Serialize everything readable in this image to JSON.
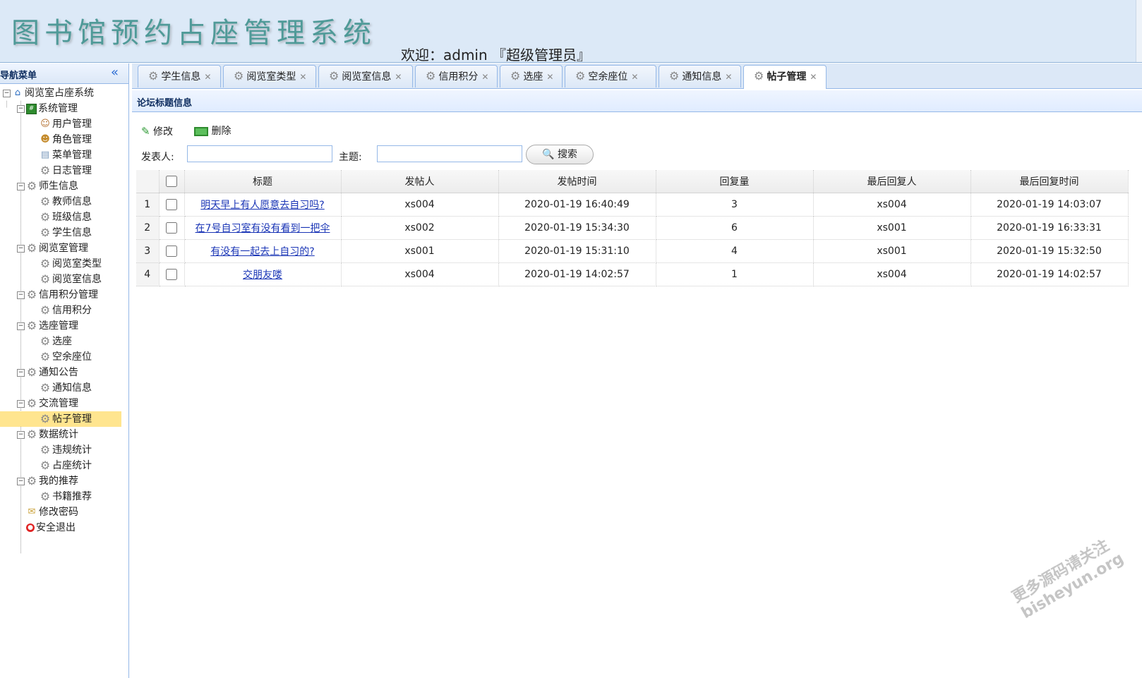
{
  "header": {
    "app_title": "图书馆预约占座管理系统",
    "welcome": "欢迎：admin 『超级管理员』"
  },
  "sidebar": {
    "title": "导航菜单",
    "collapse_icon": "double-chevron-left-icon",
    "tree": [
      {
        "label": "阅览室占座系统",
        "icon": "home-icon",
        "level": 0,
        "expanded": true
      },
      {
        "label": "系统管理",
        "icon": "system-icon",
        "level": 1,
        "expanded": true
      },
      {
        "label": "用户管理",
        "icon": "user-icon",
        "level": 2
      },
      {
        "label": "角色管理",
        "icon": "role-icon",
        "level": 2
      },
      {
        "label": "菜单管理",
        "icon": "menu-icon",
        "level": 2
      },
      {
        "label": "日志管理",
        "icon": "gear-icon",
        "level": 2
      },
      {
        "label": "师生信息",
        "icon": "gear-icon",
        "level": 1,
        "expanded": true
      },
      {
        "label": "教师信息",
        "icon": "gear-icon",
        "level": 2
      },
      {
        "label": "班级信息",
        "icon": "gear-icon",
        "level": 2
      },
      {
        "label": "学生信息",
        "icon": "gear-icon",
        "level": 2
      },
      {
        "label": "阅览室管理",
        "icon": "gear-icon",
        "level": 1,
        "expanded": true
      },
      {
        "label": "阅览室类型",
        "icon": "gear-icon",
        "level": 2
      },
      {
        "label": "阅览室信息",
        "icon": "gear-icon",
        "level": 2
      },
      {
        "label": "信用积分管理",
        "icon": "gear-icon",
        "level": 1,
        "expanded": true
      },
      {
        "label": "信用积分",
        "icon": "gear-icon",
        "level": 2
      },
      {
        "label": "选座管理",
        "icon": "gear-icon",
        "level": 1,
        "expanded": true
      },
      {
        "label": "选座",
        "icon": "gear-icon",
        "level": 2
      },
      {
        "label": "空余座位",
        "icon": "gear-icon",
        "level": 2
      },
      {
        "label": "通知公告",
        "icon": "gear-icon",
        "level": 1,
        "expanded": true
      },
      {
        "label": "通知信息",
        "icon": "gear-icon",
        "level": 2
      },
      {
        "label": "交流管理",
        "icon": "gear-icon",
        "level": 1,
        "expanded": true
      },
      {
        "label": "帖子管理",
        "icon": "gear-icon",
        "level": 2,
        "selected": true
      },
      {
        "label": "数据统计",
        "icon": "gear-icon",
        "level": 1,
        "expanded": true
      },
      {
        "label": "违规统计",
        "icon": "gear-icon",
        "level": 2
      },
      {
        "label": "占座统计",
        "icon": "gear-icon",
        "level": 2
      },
      {
        "label": "我的推荐",
        "icon": "gear-icon",
        "level": 1,
        "expanded": true
      },
      {
        "label": "书籍推荐",
        "icon": "gear-icon",
        "level": 2
      },
      {
        "label": "修改密码",
        "icon": "key-icon",
        "level": 1
      },
      {
        "label": "安全退出",
        "icon": "exit-icon",
        "level": 1
      }
    ]
  },
  "tabs": [
    {
      "label": "学生信息"
    },
    {
      "label": "阅览室类型"
    },
    {
      "label": "阅览室信息"
    },
    {
      "label": "信用积分"
    },
    {
      "label": "选座"
    },
    {
      "label": "空余座位"
    },
    {
      "label": "通知信息"
    },
    {
      "label": "帖子管理",
      "active": true
    }
  ],
  "panel": {
    "title": "论坛标题信息",
    "edit_label": "修改",
    "delete_label": "删除",
    "author_label": "发表人:",
    "subject_label": "主题:",
    "author_value": "",
    "subject_value": "",
    "search_label": "搜索"
  },
  "grid": {
    "columns": [
      "标题",
      "发帖人",
      "发帖时间",
      "回复量",
      "最后回复人",
      "最后回复时间"
    ],
    "rows": [
      {
        "no": "1",
        "title": "明天早上有人愿意去自习吗?",
        "author": "xs004",
        "time": "2020-01-19 16:40:49",
        "replies": "3",
        "last_replier": "xs004",
        "last_time": "2020-01-19 14:03:07"
      },
      {
        "no": "2",
        "title": "在7号自习室有没有看到一把伞",
        "author": "xs002",
        "time": "2020-01-19 15:34:30",
        "replies": "6",
        "last_replier": "xs001",
        "last_time": "2020-01-19 16:33:31"
      },
      {
        "no": "3",
        "title": "有没有一起去上自习的?",
        "author": "xs001",
        "time": "2020-01-19 15:31:10",
        "replies": "4",
        "last_replier": "xs001",
        "last_time": "2020-01-19 15:32:50"
      },
      {
        "no": "4",
        "title": "交朋友喽",
        "author": "xs004",
        "time": "2020-01-19 14:02:57",
        "replies": "1",
        "last_replier": "xs004",
        "last_time": "2020-01-19 14:02:57"
      }
    ]
  },
  "watermark": {
    "line1": "更多源码请关注",
    "line2": "bisheyun.org"
  }
}
